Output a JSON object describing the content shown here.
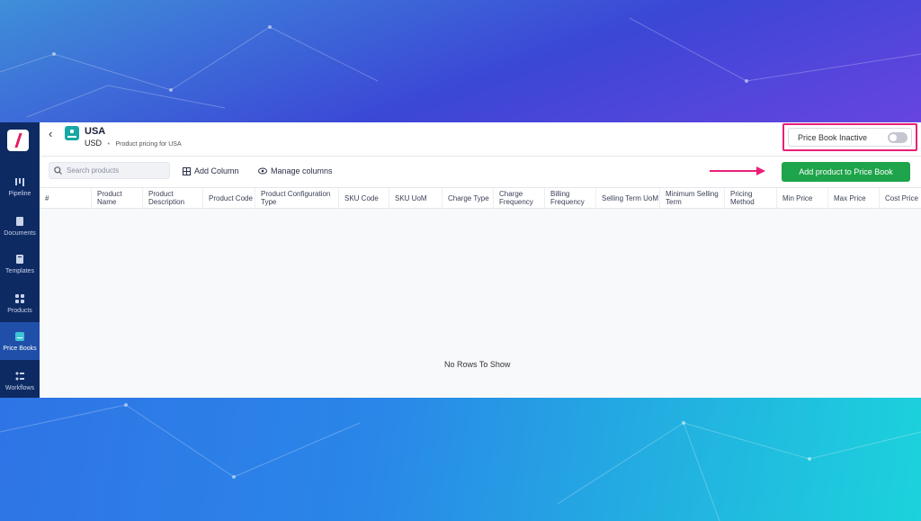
{
  "page": {
    "title": "USA",
    "currency": "USD",
    "description": "Product pricing for USA",
    "status_label": "Price Book Inactive",
    "active": false
  },
  "sidebar": {
    "items": [
      {
        "label": "Pipeline",
        "icon": "pipeline-icon"
      },
      {
        "label": "Documents",
        "icon": "documents-icon"
      },
      {
        "label": "Templates",
        "icon": "templates-icon"
      },
      {
        "label": "Products",
        "icon": "products-icon"
      },
      {
        "label": "Price Books",
        "icon": "price-books-icon",
        "active": true
      },
      {
        "label": "Workflows",
        "icon": "workflows-icon"
      }
    ]
  },
  "toolbar": {
    "search_placeholder": "Search products",
    "add_column_label": "Add Column",
    "manage_columns_label": "Manage columns",
    "add_product_label": "Add product to Price Book"
  },
  "table": {
    "columns": [
      "#",
      "Product Name",
      "Product Description",
      "Product Code",
      "Product Configuration Type",
      "SKU Code",
      "SKU UoM",
      "Charge Type",
      "Charge Frequency",
      "Billing Frequency",
      "Selling Term UoM",
      "Minimum Selling Term",
      "Pricing Method",
      "Min Price",
      "Max Price",
      "Cost Price"
    ],
    "empty_message": "No Rows To Show"
  },
  "colors": {
    "sidebar_bg": "#0d2a63",
    "sidebar_active": "#1f4fa8",
    "accent_green": "#1ea44a",
    "highlight_pink": "#ea1e78",
    "price_book_icon": "#18a8a5"
  }
}
